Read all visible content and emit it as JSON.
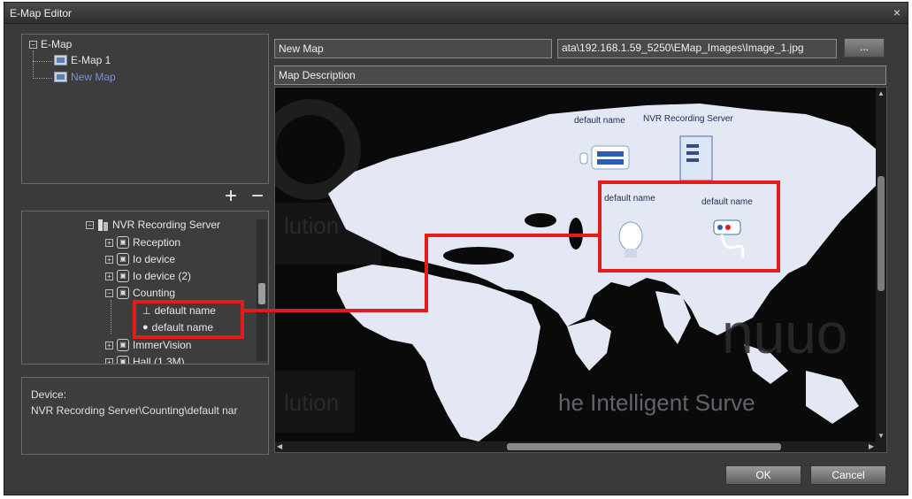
{
  "window": {
    "title": "E-Map Editor",
    "close_glyph": "×"
  },
  "map_tree": {
    "root": "E-Map",
    "items": [
      {
        "label": "E-Map 1"
      },
      {
        "label": "New Map"
      }
    ]
  },
  "tree_controls": {
    "add": "+",
    "remove": "−"
  },
  "device_tree": {
    "server": "NVR Recording Server",
    "children": [
      "Reception",
      "Io device",
      "Io device (2)",
      "Counting"
    ],
    "counting_children": [
      "default name",
      "default name"
    ],
    "after": [
      "ImmerVision",
      "Hall (1.3M)"
    ]
  },
  "device_info": {
    "label": "Device:",
    "path": "NVR Recording Server\\Counting\\default nar"
  },
  "map_fields": {
    "name": "New Map",
    "image_path": "ata\\192.168.1.59_5250\\EMap_Images\\Image_1.jpg",
    "browse_label": "...",
    "description": "Map Description"
  },
  "map_canvas": {
    "labels": {
      "device1": "default name",
      "server": "NVR Recording Server",
      "device2": "default name",
      "device3": "default name"
    },
    "watermark_1": "lution",
    "watermark_2": "lution",
    "watermark_3": "he Intelligent Surve",
    "watermark_brand": "nuuo"
  },
  "buttons": {
    "ok": "OK",
    "cancel": "Cancel"
  },
  "colors": {
    "highlight": "#e21b1b",
    "map_land": "#e3e8f4",
    "selected_text": "#7e8fd9"
  }
}
